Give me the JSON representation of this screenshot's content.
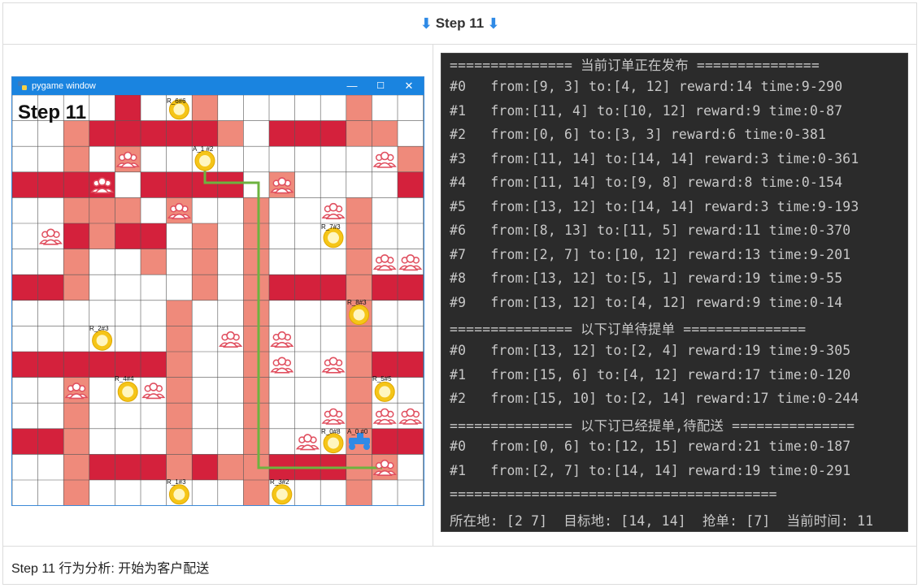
{
  "header": {
    "title": "Step 11",
    "arrow_icon": "arrow-down-icon",
    "arrow_color": "#2f8ae6"
  },
  "pygame": {
    "window_title": "pygame window",
    "step_label": "Step 11",
    "minimize_glyph": "—",
    "maximize_glyph": "☐",
    "close_glyph": "✕",
    "colors": {
      "road_major": "#d4213c",
      "road_minor": "#ef8a7b",
      "road_light": "#f3a07a",
      "route": "#6db33f",
      "coin": "#f5c518",
      "person": "#e04f5f",
      "rider": "#2f8ae6"
    },
    "legend_icons": [
      "person-icon",
      "coin-icon",
      "scooter-icon"
    ],
    "markers": {
      "r6": "R_6#6",
      "r7": "R_7#3",
      "r8": "R_8#3",
      "r2": "R_2#3",
      "r4": "R_4#4",
      "r5": "R_5#5",
      "r0": "R_0#8",
      "a0": "A_0 #0",
      "a1": "A_1 #2",
      "r1": "R_1#3",
      "r3": "R_3#2"
    }
  },
  "terminal": {
    "lines": [
      "=============== 当前订单正在发布 ===============",
      "#0   from:[9, 3] to:[4, 12] reward:14 time:9-290",
      "#1   from:[11, 4] to:[10, 12] reward:9 time:0-87",
      "#2   from:[0, 6] to:[3, 3] reward:6 time:0-381",
      "#3   from:[11, 14] to:[14, 14] reward:3 time:0-361",
      "#4   from:[11, 14] to:[9, 8] reward:8 time:0-154",
      "#5   from:[13, 12] to:[14, 14] reward:3 time:9-193",
      "#6   from:[8, 13] to:[11, 5] reward:11 time:0-370",
      "#7   from:[2, 7] to:[10, 12] reward:13 time:9-201",
      "#8   from:[13, 12] to:[5, 1] reward:19 time:9-55",
      "#9   from:[13, 12] to:[4, 12] reward:9 time:0-14",
      "=============== 以下订单待提单 ===============",
      "#0   from:[13, 12] to:[2, 4] reward:19 time:9-305",
      "#1   from:[15, 6] to:[4, 12] reward:17 time:0-120",
      "#2   from:[15, 10] to:[2, 14] reward:17 time:0-244",
      "=============== 以下订已经提单,待配送 ===============",
      "#0   from:[0, 6] to:[12, 15] reward:21 time:0-187",
      "#1   from:[2, 7] to:[14, 14] reward:19 time:0-291",
      "========================================",
      "所在地: [2 7]  目标地: [14, 14]  抢单: [7]  当前时间: 11"
    ]
  },
  "footer": {
    "text": "Step 11 行为分析:  开始为客户配送"
  }
}
